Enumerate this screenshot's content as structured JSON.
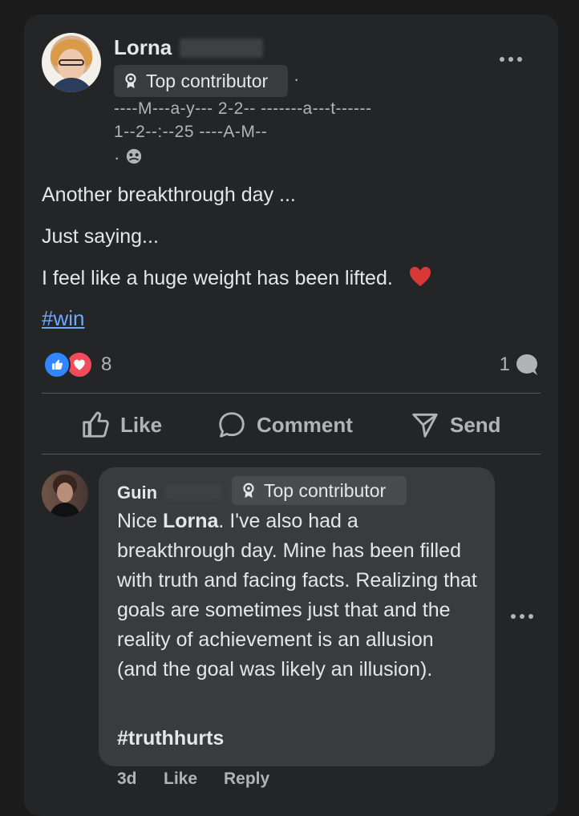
{
  "post": {
    "author_name": "Lorna",
    "badge_label": "Top contributor",
    "date_line_1": "----M---a-y--- 2-2-- -------a---t------",
    "date_line_2": " 1--2--:--25 ----A-M--",
    "visibility_dot": "·",
    "line_1": "Another breakthrough day ...",
    "line_2": "Just saying...",
    "line_3": "I feel like a huge weight has been lifted.",
    "hashtag": "#win",
    "reaction_count": "8",
    "comment_count": "1"
  },
  "actions": {
    "like": "Like",
    "comment": "Comment",
    "send": "Send"
  },
  "comment": {
    "author_name": "Guin",
    "badge_label": "Top contributor",
    "text_prefix": "Nice ",
    "mention": "Lorna",
    "text_body": ". I've also had a breakthrough day. Mine has been filled with truth and facing facts. Realizing that goals are sometimes just that and the reality of achievement is an allusion (and the goal was likely an illusion).",
    "hashtag": "#truthhurts",
    "time": "3d",
    "like": "Like",
    "reply": "Reply"
  },
  "colors": {
    "background": "#1b1b1c",
    "card": "#242526",
    "comment_bubble": "#3a3b3c",
    "accent_link": "#70a8ff",
    "like_blue": "#2f86ff",
    "love_red": "#f24b5c"
  },
  "icons": {
    "badge": "badge-icon",
    "more": "more-options-icon",
    "globe": "visibility-icon",
    "like": "thumbs-up-icon",
    "comment": "speech-bubble-icon",
    "send": "send-icon",
    "heart": "heart-icon"
  }
}
